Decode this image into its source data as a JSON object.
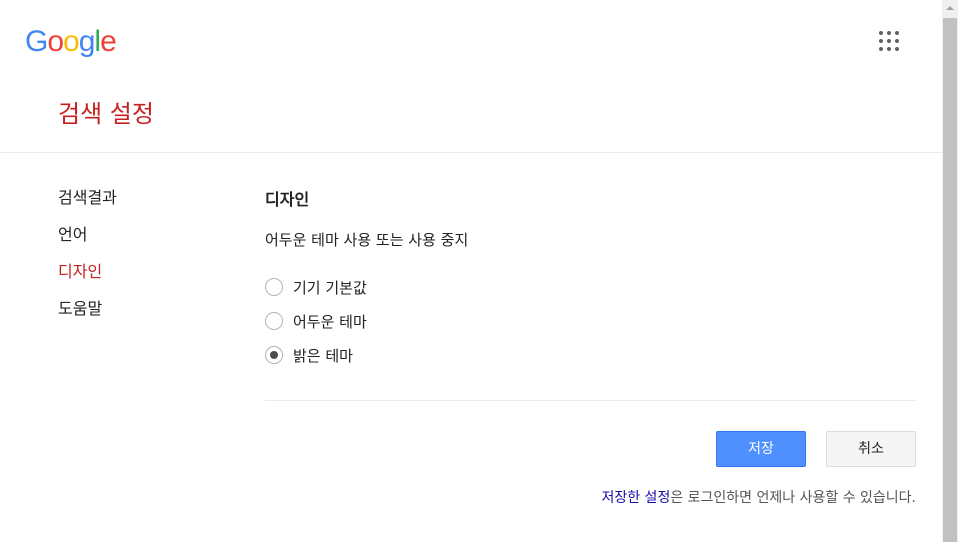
{
  "header": {
    "logo": [
      "G",
      "o",
      "o",
      "g",
      "l",
      "e"
    ],
    "logo_colors": [
      "#4285F4",
      "#EA4335",
      "#FBBC05",
      "#4285F4",
      "#34A853",
      "#EA4335"
    ],
    "apps_icon": "grid-icon"
  },
  "page_title": "검색 설정",
  "sidebar": {
    "items": [
      {
        "label": "검색결과",
        "active": false
      },
      {
        "label": "언어",
        "active": false
      },
      {
        "label": "디자인",
        "active": true
      },
      {
        "label": "도움말",
        "active": false
      }
    ]
  },
  "main": {
    "section_title": "디자인",
    "description": "어두운 테마 사용 또는 사용 중지",
    "options": [
      {
        "label": "기기 기본값",
        "checked": false
      },
      {
        "label": "어두운 테마",
        "checked": false
      },
      {
        "label": "밝은 테마",
        "checked": true
      }
    ]
  },
  "actions": {
    "save_label": "저장",
    "cancel_label": "취소"
  },
  "footer": {
    "link_text": "저장한 설정",
    "rest_text": "은 로그인하면 언제나 사용할 수 있습니다."
  },
  "colors": {
    "accent_red": "#c5221f",
    "save_blue": "#4d90fe",
    "link_blue": "#1a0dab"
  }
}
